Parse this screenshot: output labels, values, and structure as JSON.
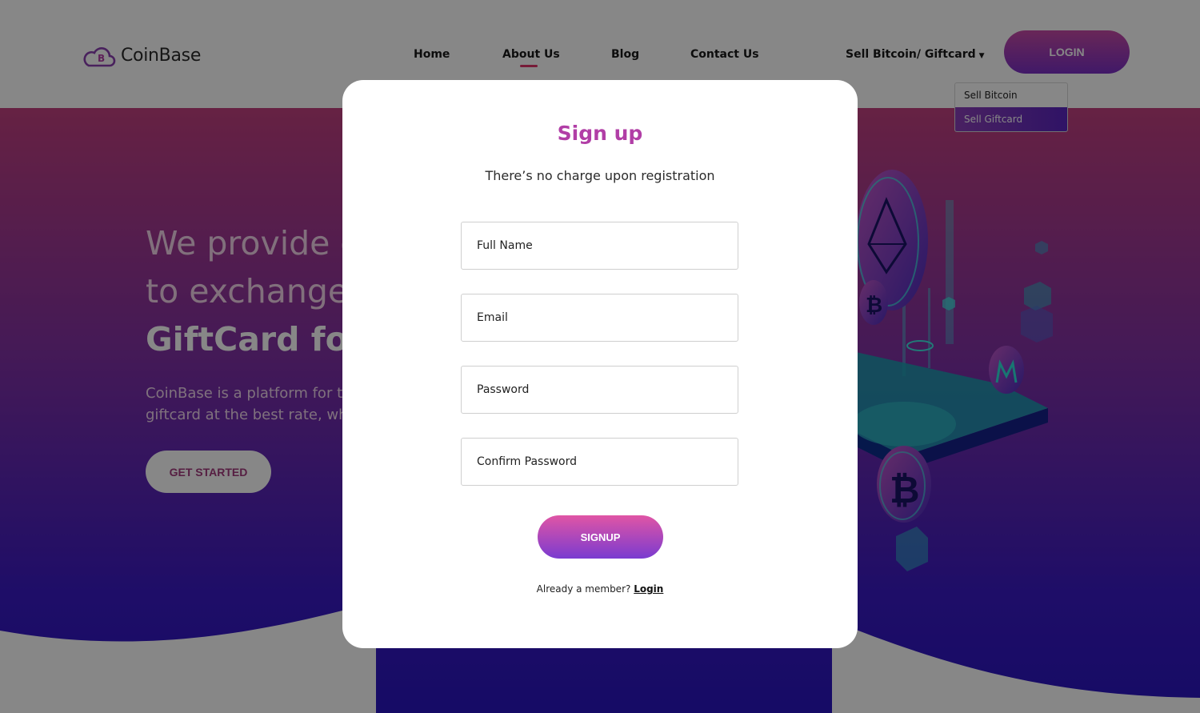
{
  "brand": {
    "name": "CoinBase",
    "logo_letter": "B"
  },
  "nav": {
    "links": [
      {
        "label": "Home"
      },
      {
        "label": "About Us",
        "active": true
      },
      {
        "label": "Blog"
      },
      {
        "label": "Contact Us"
      }
    ],
    "dropdown": {
      "label": "Sell Bitcoin/ Giftcard",
      "caret_icon": "caret-down-icon",
      "options": [
        "Sell Bitcoin",
        "Sell Giftcard"
      ],
      "selected": "Sell Giftcard"
    },
    "login_label": "LOGIN"
  },
  "hero": {
    "line1": "We provide e",
    "line2": "to exchange",
    "line3": "GiftCard for",
    "desc_line1": "CoinBase is a platform for t",
    "desc_line2": "giftcard at the best rate, wh",
    "cta_label": "GET STARTED",
    "illustration_icons": [
      "ethereum-icon",
      "bitcoin-icon",
      "monero-icon"
    ]
  },
  "modal": {
    "title": "Sign up",
    "subtitle": "There’s no charge upon registration",
    "fields": {
      "full_name": "Full Name",
      "email": "Email",
      "password": "Password",
      "confirm_password": "Confirm Password"
    },
    "submit_label": "SIGNUP",
    "member_text": "Already a member?",
    "login_link": "Login"
  },
  "colors": {
    "brand_purple": "#b13ea6",
    "hero_top": "#c1407f",
    "hero_bottom": "#2a15c0",
    "nav_active": "#e0336a"
  }
}
